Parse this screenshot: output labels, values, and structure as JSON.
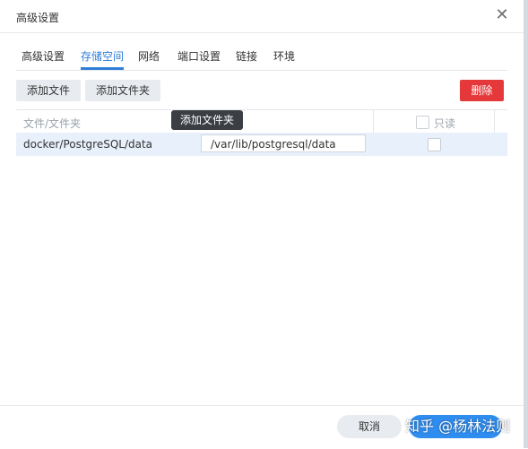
{
  "dialog": {
    "title": "高级设置",
    "close_icon": "close-icon"
  },
  "tabs": [
    {
      "label": "高级设置",
      "active": false
    },
    {
      "label": "存储空间",
      "active": true
    },
    {
      "label": "网络",
      "active": false
    },
    {
      "label": "端口设置",
      "active": false
    },
    {
      "label": "链接",
      "active": false
    },
    {
      "label": "环境",
      "active": false
    }
  ],
  "toolbar": {
    "add_file_label": "添加文件",
    "add_folder_label": "添加文件夹",
    "delete_label": "删除"
  },
  "grid": {
    "columns": {
      "file_folder": "文件/文件夹",
      "readonly": "只读"
    },
    "rows": [
      {
        "file_folder": "docker/PostgreSQL/data",
        "mount_path": "/var/lib/postgresql/data",
        "readonly": false
      }
    ]
  },
  "tooltip": {
    "text": "添加文件夹"
  },
  "footer": {
    "cancel_label": "取消"
  },
  "watermark": {
    "text": "知乎 @杨林法则"
  },
  "colors": {
    "accent": "#2f7ed8",
    "danger": "#e5383b",
    "selected_row": "#e8f0fb"
  }
}
